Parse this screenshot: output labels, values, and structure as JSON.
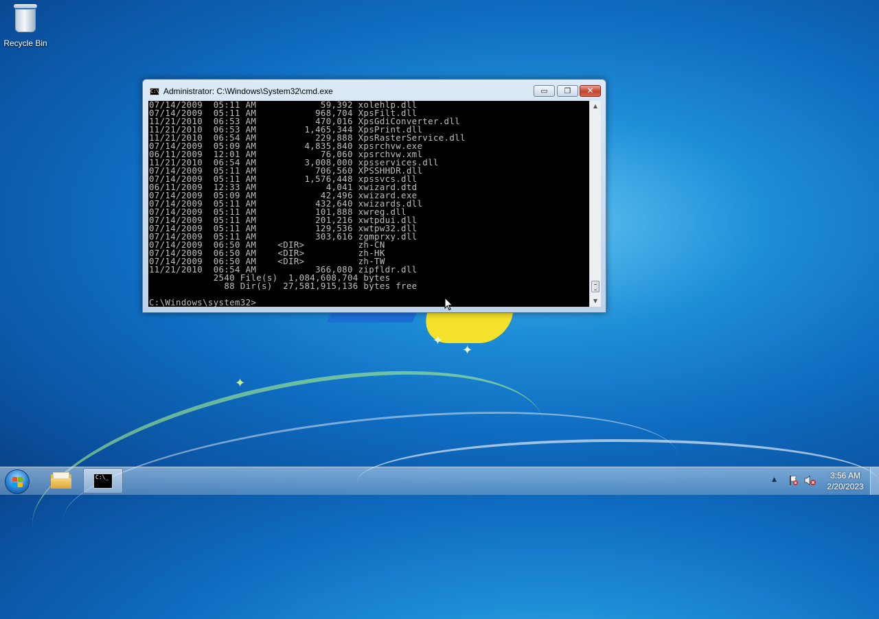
{
  "desktop": {
    "icons": [
      {
        "label": "Recycle Bin",
        "icon": "recycle-bin-icon"
      }
    ]
  },
  "window": {
    "title": "Administrator: C:\\Windows\\System32\\cmd.exe",
    "controls": {
      "minimize": "▭",
      "maximize": "❐",
      "close": "✕"
    },
    "console_lines": [
      "07/14/2009  05:11 AM            59,392 xolehlp.dll",
      "07/14/2009  05:11 AM           968,704 XpsFilt.dll",
      "11/21/2010  06:53 AM           470,016 XpsGdiConverter.dll",
      "11/21/2010  06:53 AM         1,465,344 XpsPrint.dll",
      "11/21/2010  06:54 AM           229,888 XpsRasterService.dll",
      "07/14/2009  05:09 AM         4,835,840 xpsrchvw.exe",
      "06/11/2009  12:01 AM            76,060 xpsrchvw.xml",
      "11/21/2010  06:54 AM         3,008,000 xpsservices.dll",
      "07/14/2009  05:11 AM           706,560 XPSSHHDR.dll",
      "07/14/2009  05:11 AM         1,576,448 xpssvcs.dll",
      "06/11/2009  12:33 AM             4,041 xwizard.dtd",
      "07/14/2009  05:09 AM            42,496 xwizard.exe",
      "07/14/2009  05:11 AM           432,640 xwizards.dll",
      "07/14/2009  05:11 AM           101,888 xwreg.dll",
      "07/14/2009  05:11 AM           201,216 xwtpdui.dll",
      "07/14/2009  05:11 AM           129,536 xwtpw32.dll",
      "07/14/2009  05:11 AM           303,616 zgmprxy.dll",
      "07/14/2009  06:50 AM    <DIR>          zh-CN",
      "07/14/2009  06:50 AM    <DIR>          zh-HK",
      "07/14/2009  06:50 AM    <DIR>          zh-TW",
      "11/21/2010  06:54 AM           366,080 zipfldr.dll",
      "            2540 File(s)  1,084,608,704 bytes",
      "              88 Dir(s)  27,581,915,136 bytes free",
      "",
      "C:\\Windows\\system32>"
    ]
  },
  "taskbar": {
    "items": [
      {
        "name": "start-button",
        "icon": "windows-start-orb-icon"
      },
      {
        "name": "explorer",
        "icon": "folder-icon"
      },
      {
        "name": "cmd",
        "icon": "command-prompt-icon",
        "active": true
      }
    ],
    "tray": {
      "show_hidden": "▲",
      "clock_time": "3:56 AM",
      "clock_date": "2/20/2023"
    }
  },
  "colors": {
    "console_bg": "#000000",
    "console_text": "#c0c0c0",
    "close_button": "#c7432b"
  }
}
